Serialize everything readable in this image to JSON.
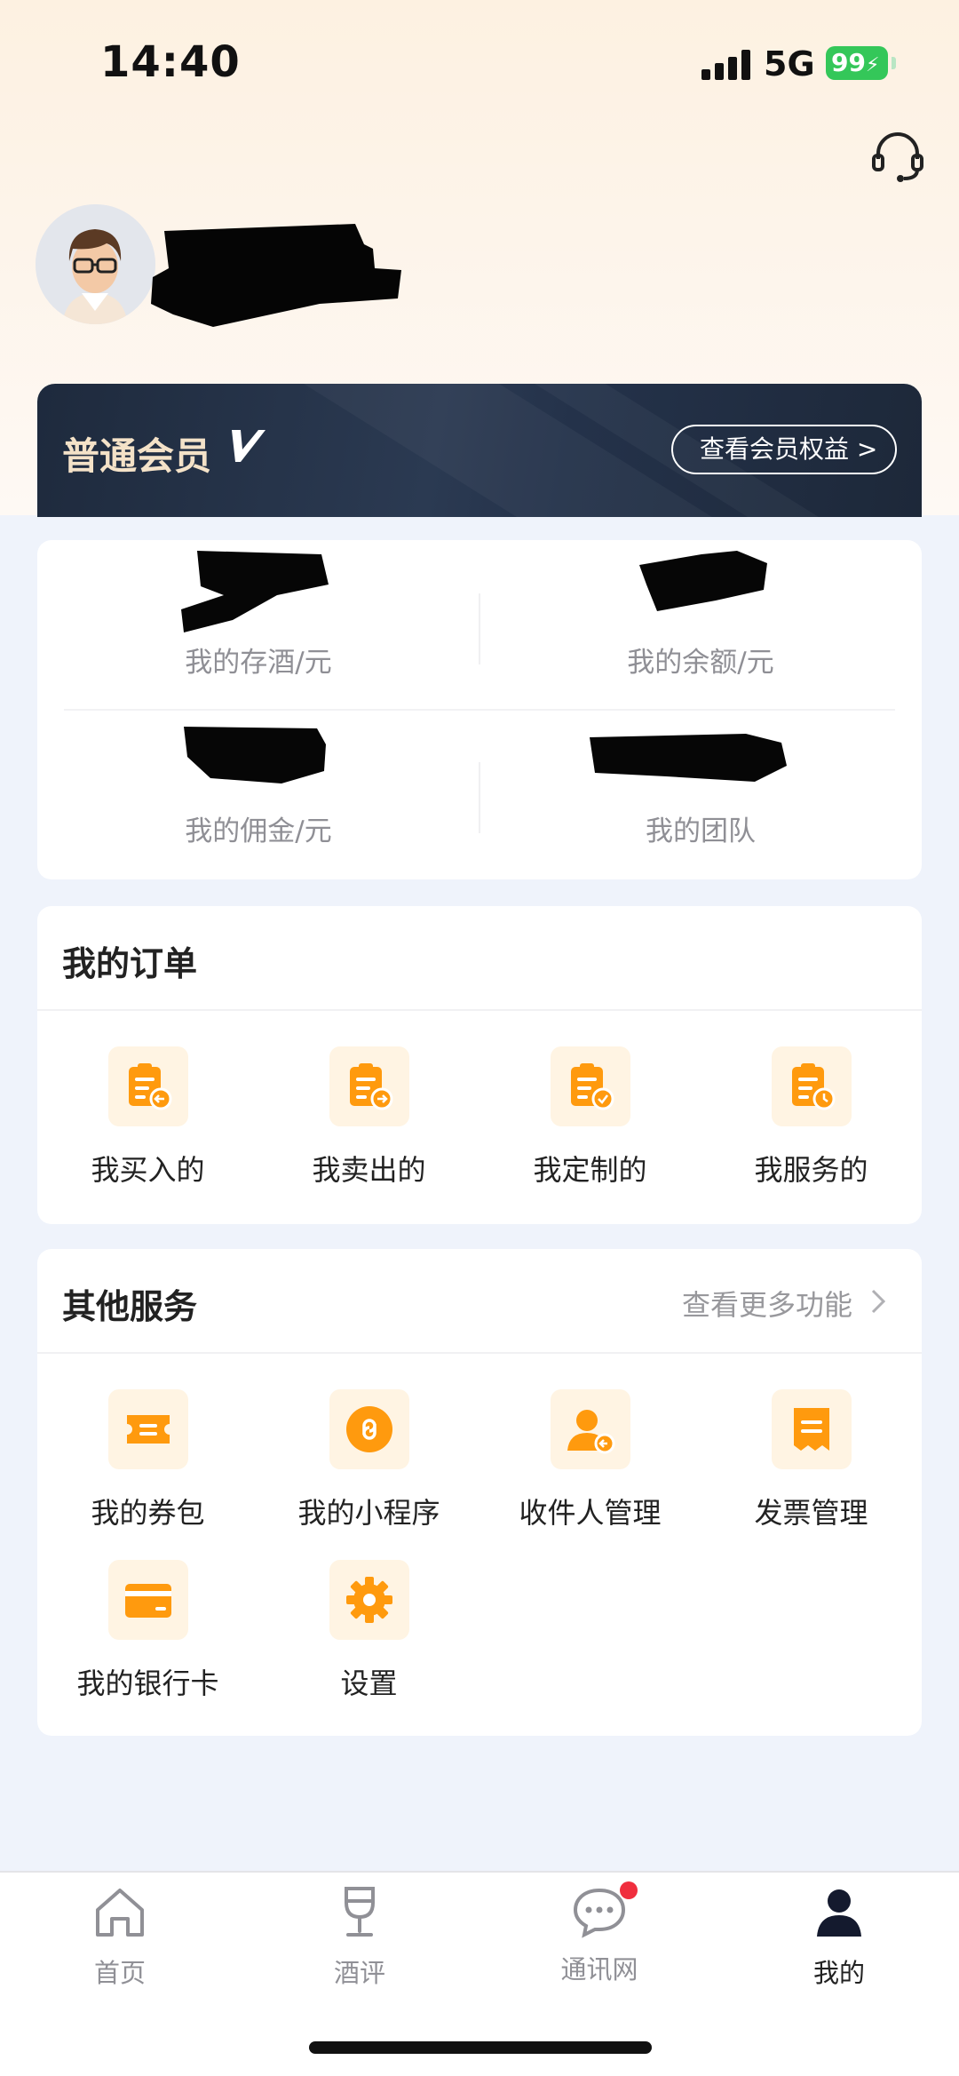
{
  "status_bar": {
    "time": "14:40",
    "network": "5G",
    "battery": "99"
  },
  "member": {
    "title": "普通会员",
    "benefits_button": "查看会员权益 >"
  },
  "stats": [
    {
      "label": "我的存酒/元"
    },
    {
      "label": "我的余额/元"
    },
    {
      "label": "我的佣金/元"
    },
    {
      "label": "我的团队"
    }
  ],
  "orders": {
    "title": "我的订单",
    "items": [
      {
        "label": "我买入的",
        "icon": "order-bought-icon"
      },
      {
        "label": "我卖出的",
        "icon": "order-sold-icon"
      },
      {
        "label": "我定制的",
        "icon": "order-custom-icon"
      },
      {
        "label": "我服务的",
        "icon": "order-service-icon"
      }
    ]
  },
  "services": {
    "title": "其他服务",
    "more_label": "查看更多功能",
    "items": [
      {
        "label": "我的券包",
        "icon": "coupon-icon"
      },
      {
        "label": "我的小程序",
        "icon": "mini-program-icon"
      },
      {
        "label": "收件人管理",
        "icon": "recipient-icon"
      },
      {
        "label": "发票管理",
        "icon": "invoice-icon"
      },
      {
        "label": "我的银行卡",
        "icon": "bank-card-icon"
      },
      {
        "label": "设置",
        "icon": "settings-gear-icon"
      }
    ]
  },
  "tabbar": {
    "tabs": [
      {
        "label": "首页",
        "icon": "home-icon"
      },
      {
        "label": "酒评",
        "icon": "wine-glass-icon"
      },
      {
        "label": "通讯网",
        "icon": "chat-icon"
      },
      {
        "label": "我的",
        "icon": "profile-icon"
      }
    ],
    "active_index": 3
  },
  "colors": {
    "accent": "#ff9a0e",
    "icon_bg": "#fff4e3",
    "badge": "#f02e3e",
    "member_bg": "#1e2a3d"
  }
}
